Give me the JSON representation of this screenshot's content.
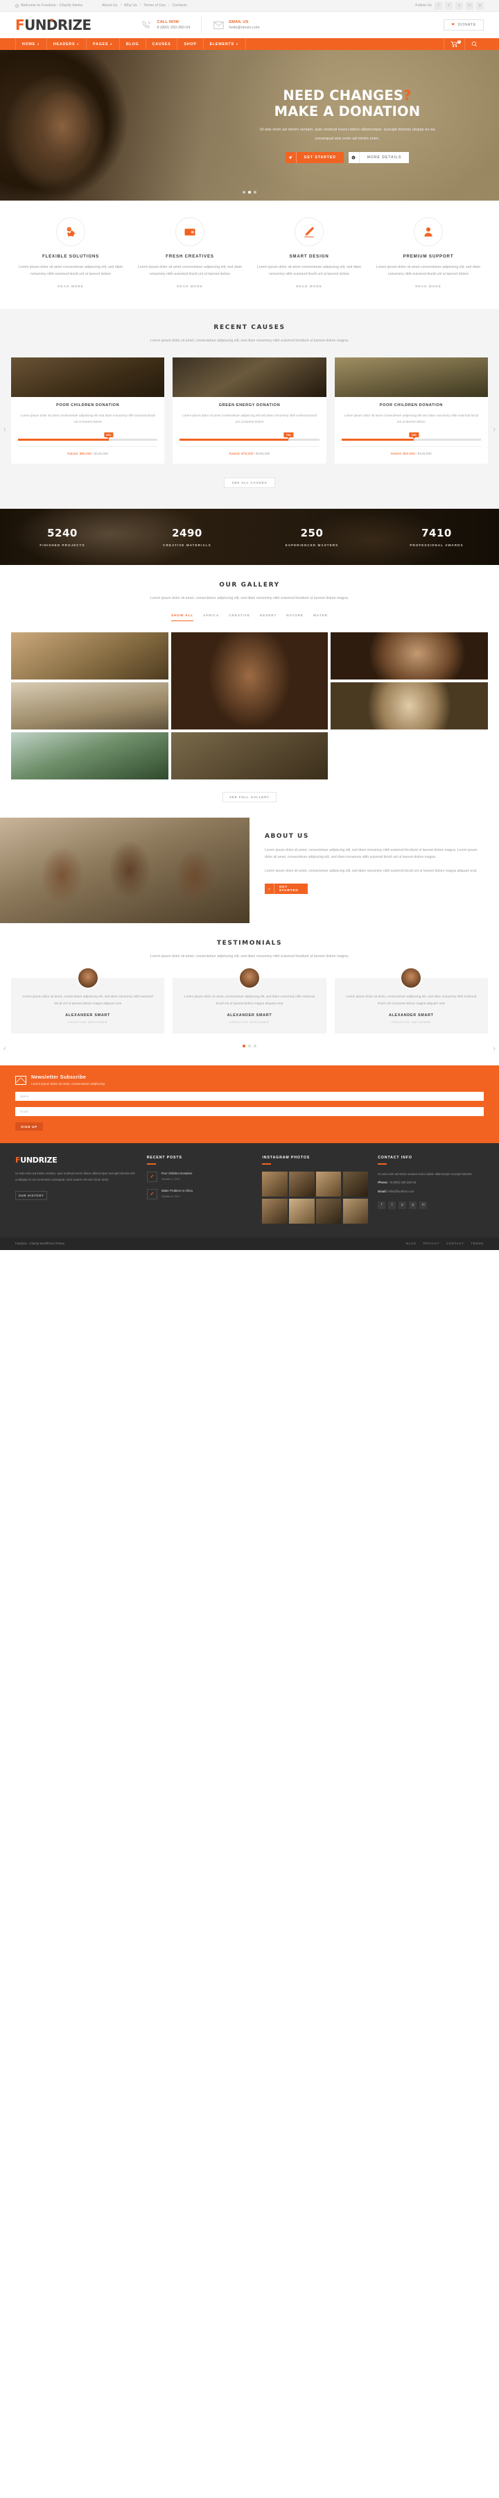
{
  "topbar": {
    "welcome": "Welcome to Fundrize - Charity theme",
    "links": [
      "About Us",
      "Why Us",
      "Terms of Use",
      "Contacts"
    ],
    "follow_label": "Follow Us",
    "social": [
      "f",
      "t",
      "v",
      "in",
      "p"
    ]
  },
  "header": {
    "logo": "FUNDRIZE",
    "logo_first": "F",
    "logo_rest": "UNDRIZE",
    "call": {
      "title": "CALL NOW",
      "value": "8 (800) 250-260-04",
      "icon": "phone-icon"
    },
    "email": {
      "title": "EMAIL US",
      "value": "hello@ninzio.com",
      "icon": "envelope-icon"
    },
    "donate_label": "DONATE"
  },
  "nav": {
    "items": [
      {
        "label": "HOME",
        "caret": true
      },
      {
        "label": "HEADERS",
        "caret": true
      },
      {
        "label": "PAGES",
        "caret": true
      },
      {
        "label": "BLOG",
        "caret": false
      },
      {
        "label": "CAUSES",
        "caret": false
      },
      {
        "label": "SHOP",
        "caret": false
      },
      {
        "label": "ELEMENTS",
        "caret": true
      }
    ],
    "cart_count": "0"
  },
  "hero": {
    "title_line1": "NEED CHANGES",
    "title_q": "?",
    "title_line2": "MAKE A DONATION",
    "paragraph": "Ut wisi enim ad minim veniam, quis nostrud exerci tation ullamcorper. suscipit lobortis aliquip ex ea consequat wisi enim ad minim enim.",
    "btn_primary": "GET STARTED",
    "btn_secondary": "MORE DETAILS",
    "dots": 3,
    "active_dot": 1
  },
  "features": [
    {
      "icon": "piggy-bank-icon",
      "title": "FLEXIBLE SOLUTIONS",
      "text": "Lorem ipsum dolor sit amet consectetuer adipiscing elit, sed diam nonummy nibh euismod tincid unt ut laoreet dolore",
      "more": "READ MORE"
    },
    {
      "icon": "wallet-icon",
      "title": "FRESH CREATIVES",
      "text": "Lorem ipsum dolor sit amet consectetuer adipiscing elit, sed diam nonummy nibh euismod tincid unt ut laoreet dolore",
      "more": "READ MORE"
    },
    {
      "icon": "pencil-icon",
      "title": "SMART DESIGN",
      "text": "Lorem ipsum dolor sit amet consectetuer adipiscing elit, sed diam nonummy nibh euismod tincid unt ut laoreet dolore",
      "more": "READ MORE"
    },
    {
      "icon": "user-support-icon",
      "title": "PREMIUM SUPPORT",
      "text": "Lorem ipsum dolor sit amet consectetuer adipiscing elit, sed diam nonummy nibh euismod tincid unt ut laoreet dolore",
      "more": "READ MORE"
    }
  ],
  "causes": {
    "title": "RECENT CAUSES",
    "subtitle": "Lorem ipsum dolor sit amet, consectetuer adipiscing elit, sed diam nonummy nibh euismod tincidunt ut laoreet dolore magna.",
    "cards": [
      {
        "title": "POOR CHILDREN DONATION",
        "text": "Lorem ipsum dolor sit amet consectetuer adipiscing elit sed diam nonummy nibh euismod tincid unt ut laoreet dolore",
        "percent": "65%",
        "percent_value": 65,
        "raised_label": "Raised:",
        "raised": "$85,000",
        "goal": "/ $125,000"
      },
      {
        "title": "GREEN ENERGY DONATION",
        "text": "Lorem ipsum dolor sit amet consectetuer adipiscing elit sed diam nonummy nibh euismod tincid unt ut laoreet dolore",
        "percent": "78%",
        "percent_value": 78,
        "raised_label": "Raised:",
        "raised": "$78,000",
        "goal": "/ $108,200"
      },
      {
        "title": "POOR CHILDREN DONATION",
        "text": "Lorem ipsum dolor sit amet consectetuer adipiscing elit sed diam nonummy nibh euismod tincid unt ut laoreet dolore",
        "percent": "52%",
        "percent_value": 52,
        "raised_label": "Raised:",
        "raised": "$60,000",
        "goal": "/ $125,000"
      }
    ],
    "see_all": "SEE ALL CAUSES",
    "arrow_prev": "‹",
    "arrow_next": "›"
  },
  "counters": [
    {
      "num": "5240",
      "label": "FINISHED PROJECTS"
    },
    {
      "num": "2490",
      "label": "CREATIVE MATERIALS"
    },
    {
      "num": "250",
      "label": "EXPERIENCED MASTERS"
    },
    {
      "num": "7410",
      "label": "PROFESSIONAL AWARDS"
    }
  ],
  "gallery": {
    "title": "OUR GALLERY",
    "subtitle": "Lorem ipsum dolor sit amet, consectetuer adipiscing elit, sed diam nonummy nibh euismod tincidunt ut laoreet dolore magna.",
    "filters": [
      "SHOW ALL",
      "AFRICA",
      "CREATIVE",
      "DESERT",
      "NATURE",
      "WATER"
    ],
    "active_filter": "SHOW ALL",
    "see_more": "SEE FULL GALLERY"
  },
  "about": {
    "title": "ABOUT US",
    "p1": "Lorem ipsum dolor sit amet, consectetuer adipiscing elit, sed diam nonummy nibh euismod tincidunt ut laoreet dolore magna. Lorem ipsum dolor sit amet, consectetuer adipiscing elit, sed diam nonummy nibh euismod tincid unt ut laoreet dolore magna.",
    "p2": "Lorem ipsum dolor sit amet, consectetuer adipiscing elit, sed diam nonummy nibh euismod tincid unt ut laoreet dolore magna aliquam erat.",
    "btn": "GET STARTED"
  },
  "testimonials": {
    "title": "TESTIMONIALS",
    "subtitle": "Lorem ipsum dolor sit amet, consectetuer adipiscing elit, sed diam nonummy nibh euismod tincidunt ut laoreet dolore magna.",
    "cards": [
      {
        "text": "Lorem ipsum dolor sit amet, consectetuer adipiscing elit, sed diam nonummy nibh euismod tincid unt ut laoreet dolore magna aliquam erat",
        "name": "ALEXANDER SMART",
        "role": "CREATIVE DESIGNER"
      },
      {
        "text": "Lorem ipsum dolor sit amet, consectetuer adipiscing elit, sed diam nonummy nibh euismod tincid unt ut laoreet dolore magna aliquam erat",
        "name": "ALEXANDER SMART",
        "role": "CREATIVE DESIGNER"
      },
      {
        "text": "Lorem ipsum dolor sit amet, consectetuer adipiscing elit, sed diam nonummy nibh euismod tincid unt ut laoreet dolore magna aliquam erat",
        "name": "ALEXANDER SMART",
        "role": "CREATIVE DESIGNER"
      }
    ],
    "dots": 3,
    "active_dot": 0,
    "arrow_prev": "‹",
    "arrow_next": "›"
  },
  "newsletter": {
    "title": "Newsletter Subscribe",
    "subtitle": "Lorem ipsum dolor sit amet, consectetuer adipiscing",
    "name_placeholder": "Name",
    "email_placeholder": "Email",
    "button": "SIGN UP"
  },
  "footer": {
    "logo_first": "F",
    "logo_rest": "UNDRIZE",
    "about": "Ut wisi enim ad minim veniam, quis nostrud exerci tation ullamcorper suscipit lobortis nisl ut aliquip ex ea commodo consequat. Duis autem vel eum iriure dolor.",
    "read_more": "OUR HISTORY",
    "posts_title": "RECENT POSTS",
    "posts": [
      {
        "title": "Poor Children Donation",
        "date": "October 2, 2017",
        "icon": "pencil-icon"
      },
      {
        "title": "Water Problem In Africa",
        "date": "October 3, 2017",
        "icon": "pencil-icon"
      }
    ],
    "instagram_title": "INSTAGRAM PHOTOS",
    "contact_title": "CONTACT INFO",
    "contact_text": "Ut wisi enim ad minim veniam exerci tation ullamcorper suscipit lobortis.",
    "phone_label": "Phone:",
    "phone": "+8 (800) 250-250-03",
    "email_label": "Email:",
    "email": "hello@fundrize.com",
    "social": [
      "f",
      "t",
      "p",
      "g",
      "in"
    ]
  },
  "copyright": {
    "text": "Fundrize - Charity WordPress Theme.",
    "links": [
      "BLOG",
      "PRIVACY",
      "CONTACT",
      "TERMS"
    ]
  },
  "colors": {
    "accent": "#f26322",
    "dark": "#2f2f2f",
    "light_gray": "#f4f4f4"
  }
}
